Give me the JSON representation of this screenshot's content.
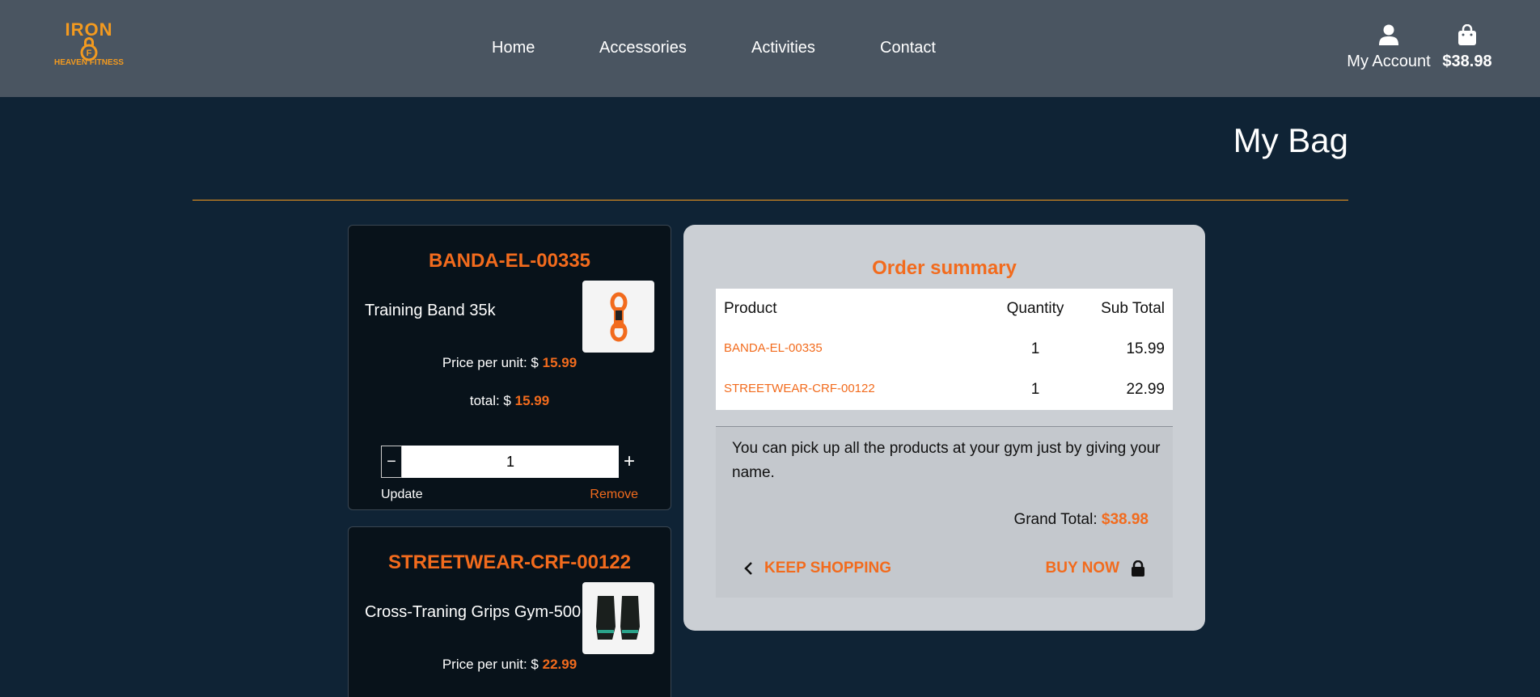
{
  "header": {
    "logo_top": "IRON",
    "logo_bottom": "HEAVEN FITNESS",
    "nav": [
      "Home",
      "Accessories",
      "Activities",
      "Contact"
    ],
    "account_label": "My Account",
    "cart_total": "$38.98"
  },
  "page": {
    "title": "My Bag"
  },
  "bag_items": [
    {
      "code": "BANDA-EL-00335",
      "name": "Training Band 35k",
      "price_label": "Price per unit: $ ",
      "price": "15.99",
      "total_label": "total: $ ",
      "total": "15.99",
      "quantity": "1",
      "update_label": "Update",
      "remove_label": "Remove"
    },
    {
      "code": "STREETWEAR-CRF-00122",
      "name": "Cross-Traning Grips Gym-500",
      "price_label": "Price per unit: $ ",
      "price": "22.99"
    }
  ],
  "summary": {
    "title": "Order summary",
    "headers": [
      "Product",
      "Quantity",
      "Sub Total"
    ],
    "rows": [
      {
        "product": "BANDA-EL-00335",
        "quantity": "1",
        "subtotal": "15.99"
      },
      {
        "product": "STREETWEAR-CRF-00122",
        "quantity": "1",
        "subtotal": "22.99"
      }
    ],
    "pickup_note": "You can pick up all the products at your gym just by giving your name.",
    "grand_total_label": "Grand Total: ",
    "grand_total": "$38.98",
    "keep_shopping": "KEEP SHOPPING",
    "buy_now": "BUY NOW"
  },
  "colors": {
    "accent": "#f26b1d",
    "logo": "#f39a1f",
    "navbar": "#4a5561",
    "background": "#0f2335"
  }
}
